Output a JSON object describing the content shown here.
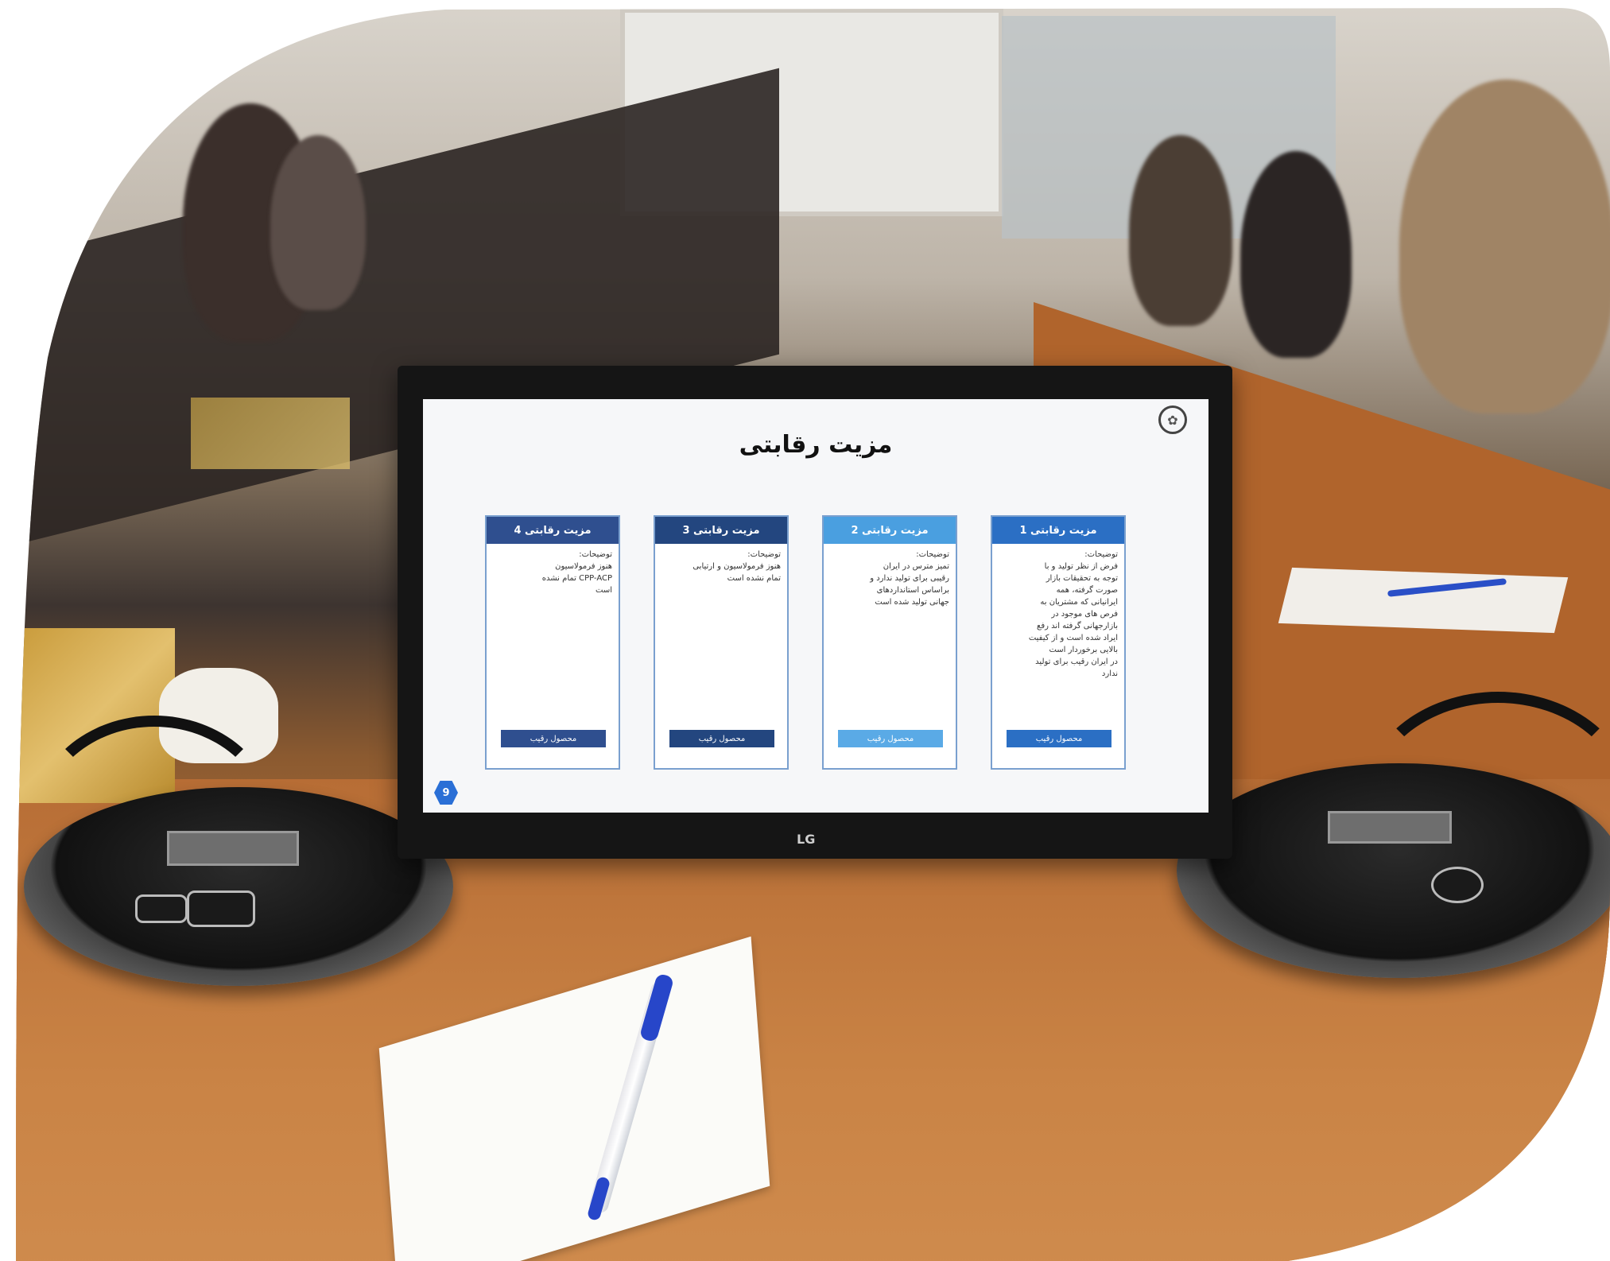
{
  "monitor": {
    "brand": "LG"
  },
  "slide": {
    "title": "مزیت رقابتی",
    "page_number": "9",
    "cards": [
      {
        "heading": "مزیت رقابتی 4",
        "body": "توضیحات:\nهنوز فرمولاسیون\nCPP-ACP تمام نشده\nاست",
        "button": "محصول رقیب",
        "header_color": "#2f4f8f",
        "button_color": "#2f4f8f"
      },
      {
        "heading": "مزیت رقابتی 3",
        "body": "توضیحات:\nهنوز فرمولاسیون و ارتیابی\nتمام نشده است",
        "button": "محصول رقیب",
        "header_color": "#23467f",
        "button_color": "#23467f"
      },
      {
        "heading": "مزیت رقابتی 2",
        "body": "توضیحات:\nتمیز مترس در ایران\nرقیبی برای تولید ندارد و\nبراساس استانداردهای\nجهانی تولید شده است",
        "button": "محصول رقیب",
        "header_color": "#4a9fe0",
        "button_color": "#5aaae6"
      },
      {
        "heading": "مزیت رقابتی 1",
        "body": "توضیحات:\nفرض از نظر تولید و با\nتوجه به تحقیقات بازار\nصورت گرفته، همه\nایرانیانی که مشتریان به\nفرص های موجود در\nبازارجهانی گرفته اند رفع\nایراد شده است و از کیفیت\nبالایی برخوردار است\nدر ایران رقیب برای تولید\nندارد",
        "button": "محصول رقیب",
        "header_color": "#2b6fc4",
        "button_color": "#2b6fc4"
      }
    ]
  }
}
